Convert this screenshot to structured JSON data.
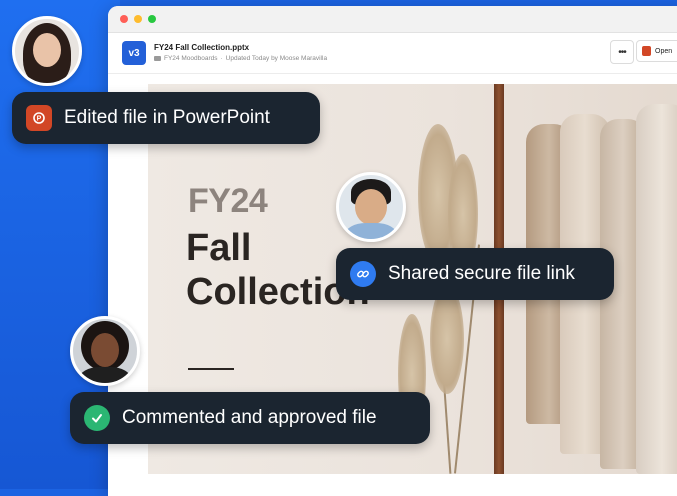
{
  "window": {
    "version_badge": "v3",
    "file_name": "FY24 Fall Collection.pptx",
    "folder": "FY24 Moodboards",
    "updated": "Updated Today by Moose Maravilla",
    "more_label": "•••",
    "open_label": "Open"
  },
  "slide": {
    "fy_label": "FY24",
    "title_line1": "Fall",
    "title_line2": "Collection"
  },
  "activity": [
    {
      "text": "Edited file in PowerPoint",
      "icon": "powerpoint-icon"
    },
    {
      "text": "Shared secure file link",
      "icon": "link-icon"
    },
    {
      "text": "Commented and approved file",
      "icon": "checkmark-icon"
    }
  ],
  "colors": {
    "brand_blue": "#1c63e2",
    "card_bg": "#1b2530",
    "powerpoint": "#d24726",
    "link_blue": "#2f7bf0",
    "approve_green": "#2bb673"
  }
}
